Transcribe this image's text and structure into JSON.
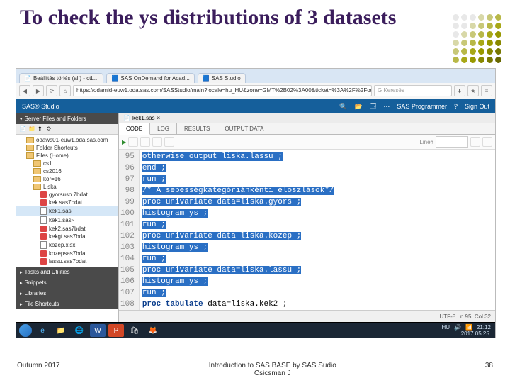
{
  "title": "To check the ys distributions of 3 datasets",
  "footer": {
    "left": "Outumn 2017",
    "center": "Introduction to SAS BASE by SAS Sudio\nCsicsman J",
    "right": "38"
  },
  "browser": {
    "tabs": [
      "Beállítás törlés (all) - ctL...",
      "SAS OnDemand for Acad...",
      "SAS Studio"
    ],
    "url": "https://odamid-euw1.oda.sas.com/SASStudio/main?locale=hu_HU&zone=GMT%2B02%3A00&ticket=%3A%2F%2Fodamid-o",
    "search_placeholder": "Keresés"
  },
  "sasbar": {
    "brand": "SAS® Studio",
    "right": [
      "SAS Programmer",
      "Sign Out"
    ]
  },
  "sidebar": {
    "sections": [
      "Server Files and Folders",
      "Tasks and Utilities",
      "Snippets",
      "Libraries",
      "File Shortcuts"
    ],
    "root": "odaws01-euw1.oda.sas.com",
    "folders": [
      {
        "label": "Folder Shortcuts"
      },
      {
        "label": "Files (Home)",
        "children": [
          {
            "label": "cs1",
            "type": "folder"
          },
          {
            "label": "cs2016",
            "type": "folder"
          },
          {
            "label": "kor=16",
            "type": "folder"
          },
          {
            "label": "Liska",
            "type": "folder",
            "children": [
              {
                "label": "gyorsuso.7bdat",
                "type": "ds"
              },
              {
                "label": "kek.sas7bdat",
                "type": "ds"
              },
              {
                "label": "kek1.sas",
                "type": "file",
                "selected": true
              },
              {
                "label": "kek1.sas~",
                "type": "file"
              },
              {
                "label": "kek2.sas7bdat",
                "type": "ds"
              },
              {
                "label": "kekgt.sas7bdat",
                "type": "ds"
              },
              {
                "label": "kozep.xlsx",
                "type": "file"
              },
              {
                "label": "kozepsas7bdat",
                "type": "ds"
              },
              {
                "label": "lassu.sas7bdat",
                "type": "ds"
              }
            ]
          }
        ]
      }
    ]
  },
  "editor": {
    "filename_tab": "kek1.sas",
    "tabs": [
      "CODE",
      "LOG",
      "RESULTS",
      "OUTPUT DATA"
    ],
    "active_tab": "CODE",
    "toolbar_right": "Line#",
    "line_start": 95,
    "lines": [
      {
        "n": 95,
        "text": "otherwise output liska.lassu ;",
        "hl": true
      },
      {
        "n": 96,
        "text": "end ;",
        "hl": true
      },
      {
        "n": 97,
        "text": "run ;",
        "hl": true,
        "kw": true
      },
      {
        "n": 98,
        "text": "/* A sebességkategóriánkénti eloszlások*/",
        "hl": true,
        "cmt": true
      },
      {
        "n": 99,
        "text": "proc univariate data=liska.gyors ;",
        "hl": true
      },
      {
        "n": 100,
        "text": "histogram ys ;",
        "hl": true
      },
      {
        "n": 101,
        "text": "run ;",
        "hl": true,
        "kw": true
      },
      {
        "n": 102,
        "text": "proc univariate data liska.kozep ;",
        "hl": true
      },
      {
        "n": 103,
        "text": "histogram ys ;",
        "hl": true
      },
      {
        "n": 104,
        "text": "run ;",
        "hl": true,
        "kw": true
      },
      {
        "n": 105,
        "text": "proc univariate data=liska.lassu ;",
        "hl": true
      },
      {
        "n": 106,
        "text": "histogram ys ;",
        "hl": true
      },
      {
        "n": 107,
        "text": "run ;",
        "hl": true,
        "kw": true
      },
      {
        "n": 108,
        "text": "proc tabulate data=liska.kek2 ;",
        "hl": false
      }
    ],
    "status_right": "UTF-8   Ln 95, Col 32"
  },
  "taskbar": {
    "clock_time": "21:12",
    "clock_date": "2017.05.25."
  },
  "dot_colors": [
    "#e8e8e8",
    "#e8e8e8",
    "#e8e8e8",
    "#d8d8a8",
    "#c8c878",
    "#b8b848",
    "#e8e8e8",
    "#e8e8e8",
    "#d8d8a8",
    "#c8c878",
    "#b8b848",
    "#a8a818",
    "#e8e8e8",
    "#d8d8a8",
    "#c8c878",
    "#b8b848",
    "#a8a818",
    "#989800",
    "#d8d8a8",
    "#c8c878",
    "#b8b848",
    "#a8a818",
    "#989800",
    "#888800",
    "#c8c878",
    "#b8b848",
    "#a8a818",
    "#989800",
    "#888800",
    "#787800",
    "#b8b848",
    "#a8a818",
    "#989800",
    "#888800",
    "#787800",
    "#686800"
  ]
}
